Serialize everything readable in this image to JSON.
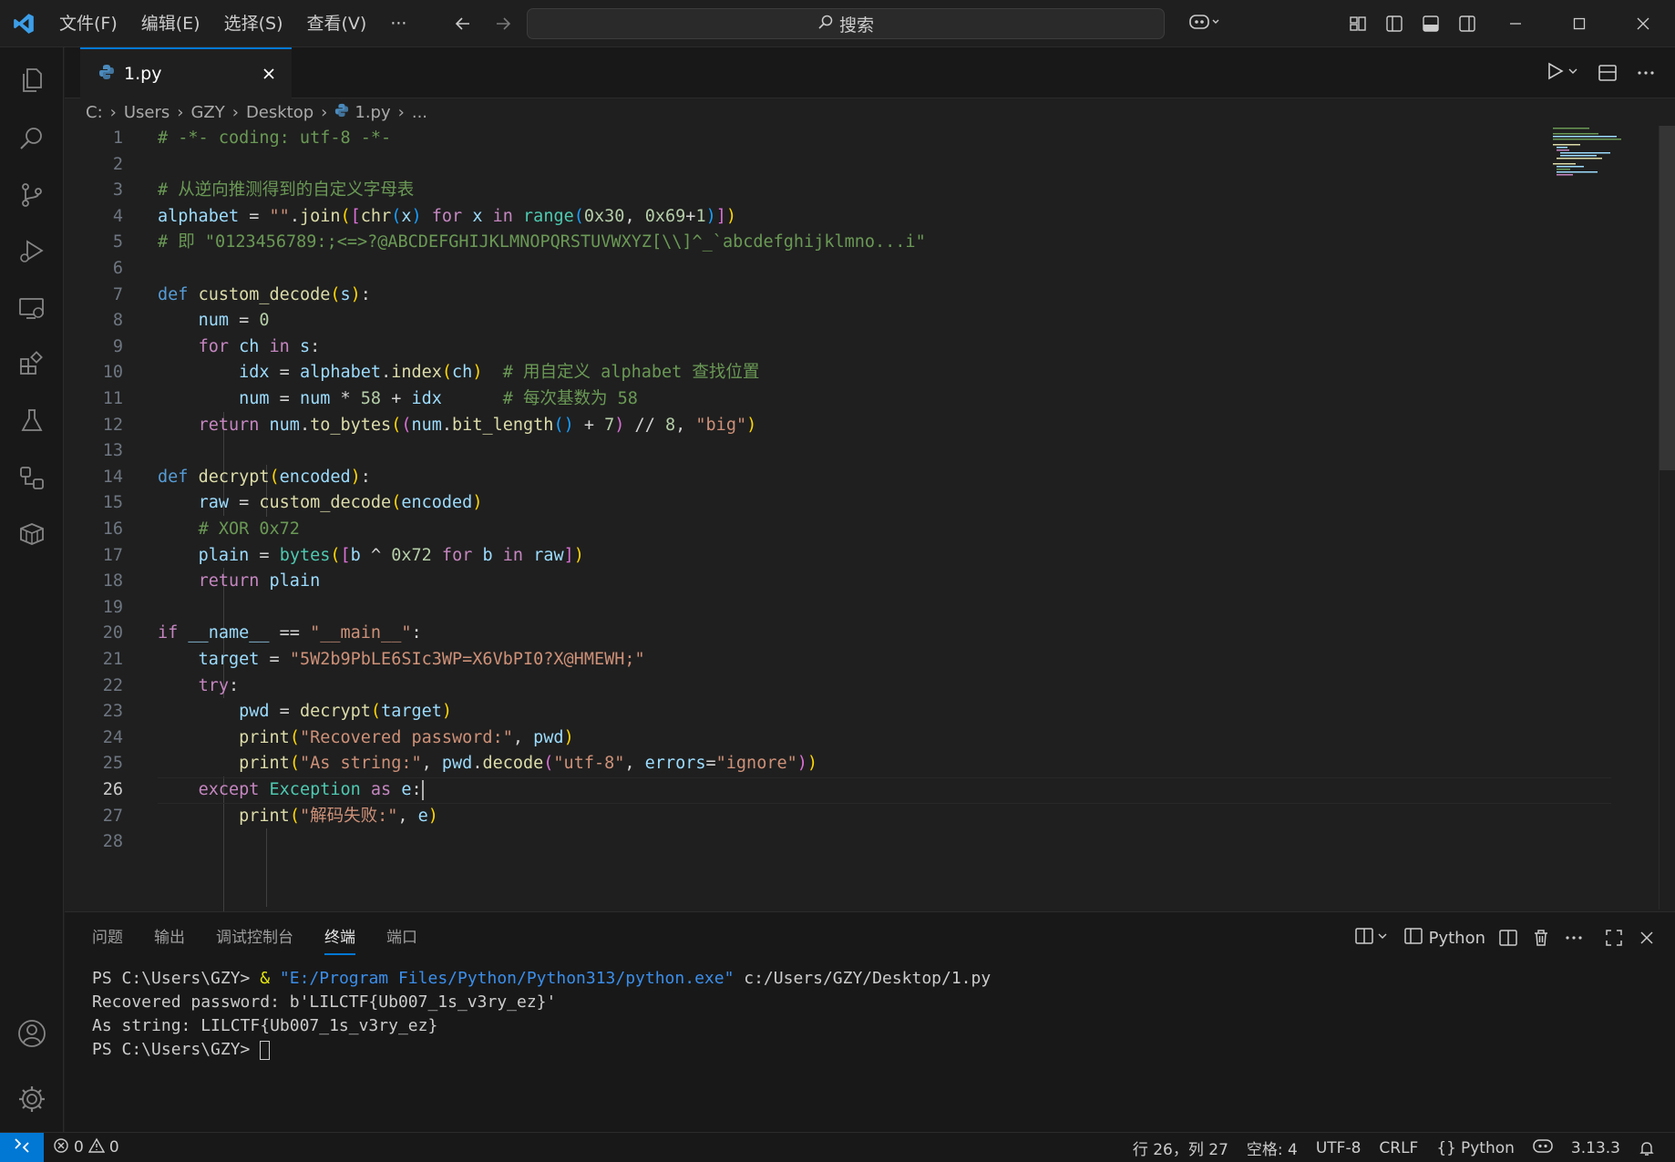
{
  "menu": [
    "文件(F)",
    "编辑(E)",
    "选择(S)",
    "查看(V)",
    "···"
  ],
  "search": {
    "label": "搜索"
  },
  "tab": {
    "label": "1.py"
  },
  "breadcrumb": [
    "C:",
    "Users",
    "GZY",
    "Desktop",
    "1.py",
    "..."
  ],
  "code": {
    "current_line": 26,
    "lines": [
      [
        [
          "c-com",
          "# -*- coding: utf-8 -*-"
        ]
      ],
      [],
      [
        [
          "c-com",
          "# 从逆向推测得到的自定义字母表"
        ]
      ],
      [
        [
          "c-var",
          "alphabet"
        ],
        [
          "c-op",
          " = "
        ],
        [
          "c-str",
          "\"\""
        ],
        [
          "c-op",
          "."
        ],
        [
          "c-fn",
          "join"
        ],
        [
          "c-b1",
          "("
        ],
        [
          "c-b2",
          "["
        ],
        [
          "c-fn",
          "chr"
        ],
        [
          "c-b3",
          "("
        ],
        [
          "c-var",
          "x"
        ],
        [
          "c-b3",
          ")"
        ],
        [
          "c-kw",
          " for "
        ],
        [
          "c-var",
          "x"
        ],
        [
          "c-kw",
          " in "
        ],
        [
          "c-cls",
          "range"
        ],
        [
          "c-b3",
          "("
        ],
        [
          "c-num",
          "0x30"
        ],
        [
          "c-op",
          ", "
        ],
        [
          "c-num",
          "0x69"
        ],
        [
          "c-op",
          "+"
        ],
        [
          "c-num",
          "1"
        ],
        [
          "c-b3",
          ")"
        ],
        [
          "c-b2",
          "]"
        ],
        [
          "c-b1",
          ")"
        ]
      ],
      [
        [
          "c-com",
          "# 即 \"0123456789:;<=>?@ABCDEFGHIJKLMNOPQRSTUVWXYZ[\\\\]^_`abcdefghijklmno...i\""
        ]
      ],
      [],
      [
        [
          "c-def",
          "def "
        ],
        [
          "c-fn",
          "custom_decode"
        ],
        [
          "c-b1",
          "("
        ],
        [
          "c-var",
          "s"
        ],
        [
          "c-b1",
          ")"
        ],
        [
          "c-op",
          ":"
        ]
      ],
      [
        [
          "c-op",
          "    "
        ],
        [
          "c-var",
          "num"
        ],
        [
          "c-op",
          " = "
        ],
        [
          "c-num",
          "0"
        ]
      ],
      [
        [
          "c-op",
          "    "
        ],
        [
          "c-kw",
          "for "
        ],
        [
          "c-var",
          "ch"
        ],
        [
          "c-kw",
          " in "
        ],
        [
          "c-var",
          "s"
        ],
        [
          "c-op",
          ":"
        ]
      ],
      [
        [
          "c-op",
          "        "
        ],
        [
          "c-var",
          "idx"
        ],
        [
          "c-op",
          " = "
        ],
        [
          "c-var",
          "alphabet"
        ],
        [
          "c-op",
          "."
        ],
        [
          "c-fn",
          "index"
        ],
        [
          "c-b1",
          "("
        ],
        [
          "c-var",
          "ch"
        ],
        [
          "c-b1",
          ")"
        ],
        [
          "c-op",
          "  "
        ],
        [
          "c-com",
          "# 用自定义 alphabet 查找位置"
        ]
      ],
      [
        [
          "c-op",
          "        "
        ],
        [
          "c-var",
          "num"
        ],
        [
          "c-op",
          " = "
        ],
        [
          "c-var",
          "num"
        ],
        [
          "c-op",
          " * "
        ],
        [
          "c-num",
          "58"
        ],
        [
          "c-op",
          " + "
        ],
        [
          "c-var",
          "idx"
        ],
        [
          "c-op",
          "      "
        ],
        [
          "c-com",
          "# 每次基数为 58"
        ]
      ],
      [
        [
          "c-op",
          "    "
        ],
        [
          "c-kw",
          "return "
        ],
        [
          "c-var",
          "num"
        ],
        [
          "c-op",
          "."
        ],
        [
          "c-fn",
          "to_bytes"
        ],
        [
          "c-b1",
          "("
        ],
        [
          "c-b2",
          "("
        ],
        [
          "c-var",
          "num"
        ],
        [
          "c-op",
          "."
        ],
        [
          "c-fn",
          "bit_length"
        ],
        [
          "c-b3",
          "()"
        ],
        [
          "c-op",
          " + "
        ],
        [
          "c-num",
          "7"
        ],
        [
          "c-b2",
          ")"
        ],
        [
          "c-op",
          " // "
        ],
        [
          "c-num",
          "8"
        ],
        [
          "c-op",
          ", "
        ],
        [
          "c-str",
          "\"big\""
        ],
        [
          "c-b1",
          ")"
        ]
      ],
      [],
      [
        [
          "c-def",
          "def "
        ],
        [
          "c-fn",
          "decrypt"
        ],
        [
          "c-b1",
          "("
        ],
        [
          "c-var",
          "encoded"
        ],
        [
          "c-b1",
          ")"
        ],
        [
          "c-op",
          ":"
        ]
      ],
      [
        [
          "c-op",
          "    "
        ],
        [
          "c-var",
          "raw"
        ],
        [
          "c-op",
          " = "
        ],
        [
          "c-fn",
          "custom_decode"
        ],
        [
          "c-b1",
          "("
        ],
        [
          "c-var",
          "encoded"
        ],
        [
          "c-b1",
          ")"
        ]
      ],
      [
        [
          "c-op",
          "    "
        ],
        [
          "c-com",
          "# XOR 0x72"
        ]
      ],
      [
        [
          "c-op",
          "    "
        ],
        [
          "c-var",
          "plain"
        ],
        [
          "c-op",
          " = "
        ],
        [
          "c-cls",
          "bytes"
        ],
        [
          "c-b1",
          "("
        ],
        [
          "c-b2",
          "["
        ],
        [
          "c-var",
          "b"
        ],
        [
          "c-op",
          " ^ "
        ],
        [
          "c-num",
          "0x72"
        ],
        [
          "c-kw",
          " for "
        ],
        [
          "c-var",
          "b"
        ],
        [
          "c-kw",
          " in "
        ],
        [
          "c-var",
          "raw"
        ],
        [
          "c-b2",
          "]"
        ],
        [
          "c-b1",
          ")"
        ]
      ],
      [
        [
          "c-op",
          "    "
        ],
        [
          "c-kw",
          "return "
        ],
        [
          "c-var",
          "plain"
        ]
      ],
      [],
      [
        [
          "c-kw",
          "if "
        ],
        [
          "c-var",
          "__name__"
        ],
        [
          "c-op",
          " == "
        ],
        [
          "c-str",
          "\"__main__\""
        ],
        [
          "c-op",
          ":"
        ]
      ],
      [
        [
          "c-op",
          "    "
        ],
        [
          "c-var",
          "target"
        ],
        [
          "c-op",
          " = "
        ],
        [
          "c-str",
          "\"5W2b9PbLE6SIc3WP=X6VbPI0?X@HMEWH;\""
        ]
      ],
      [
        [
          "c-op",
          "    "
        ],
        [
          "c-kw",
          "try"
        ],
        [
          "c-op",
          ":"
        ]
      ],
      [
        [
          "c-op",
          "        "
        ],
        [
          "c-var",
          "pwd"
        ],
        [
          "c-op",
          " = "
        ],
        [
          "c-fn",
          "decrypt"
        ],
        [
          "c-b1",
          "("
        ],
        [
          "c-var",
          "target"
        ],
        [
          "c-b1",
          ")"
        ]
      ],
      [
        [
          "c-op",
          "        "
        ],
        [
          "c-fn",
          "print"
        ],
        [
          "c-b1",
          "("
        ],
        [
          "c-str",
          "\"Recovered password:\""
        ],
        [
          "c-op",
          ", "
        ],
        [
          "c-var",
          "pwd"
        ],
        [
          "c-b1",
          ")"
        ]
      ],
      [
        [
          "c-op",
          "        "
        ],
        [
          "c-fn",
          "print"
        ],
        [
          "c-b1",
          "("
        ],
        [
          "c-str",
          "\"As string:\""
        ],
        [
          "c-op",
          ", "
        ],
        [
          "c-var",
          "pwd"
        ],
        [
          "c-op",
          "."
        ],
        [
          "c-fn",
          "decode"
        ],
        [
          "c-b2",
          "("
        ],
        [
          "c-str",
          "\"utf-8\""
        ],
        [
          "c-op",
          ", "
        ],
        [
          "c-var",
          "errors"
        ],
        [
          "c-op",
          "="
        ],
        [
          "c-str",
          "\"ignore\""
        ],
        [
          "c-b2",
          ")"
        ],
        [
          "c-b1",
          ")"
        ]
      ],
      [
        [
          "c-op",
          "    "
        ],
        [
          "c-kw",
          "except "
        ],
        [
          "c-cls",
          "Exception"
        ],
        [
          "c-kw",
          " as "
        ],
        [
          "c-var",
          "e"
        ],
        [
          "c-op",
          ":"
        ]
      ],
      [
        [
          "c-op",
          "        "
        ],
        [
          "c-fn",
          "print"
        ],
        [
          "c-b1",
          "("
        ],
        [
          "c-str",
          "\"解码失败:\""
        ],
        [
          "c-op",
          ", "
        ],
        [
          "c-var",
          "e"
        ],
        [
          "c-b1",
          ")"
        ]
      ],
      []
    ]
  },
  "panel": {
    "tabs": [
      "问题",
      "输出",
      "调试控制台",
      "终端",
      "端口"
    ],
    "active_tab": "终端",
    "shell_label": "Python",
    "terminal": {
      "prompt": "PS C:\\Users\\GZY> ",
      "cmd_amp": "& ",
      "cmd_path": "\"E:/Program Files/Python/Python313/python.exe\"",
      "cmd_arg": " c:/Users/GZY/Desktop/1.py",
      "out1": "Recovered password: b'LILCTF{Ub007_1s_v3ry_ez}'",
      "out2": "As string: LILCTF{Ub007_1s_v3ry_ez}",
      "prompt2": "PS C:\\Users\\GZY> "
    }
  },
  "status": {
    "errors": "0",
    "warnings": "0",
    "position": "行 26，列 27",
    "spaces": "空格: 4",
    "encoding": "UTF-8",
    "eol": "CRLF",
    "language": "Python",
    "language_prefix": "{}",
    "python_version": "3.13.3"
  },
  "colors": {
    "accent": "#0078d4",
    "background": "#1f1f1f",
    "sidebar": "#181818"
  }
}
